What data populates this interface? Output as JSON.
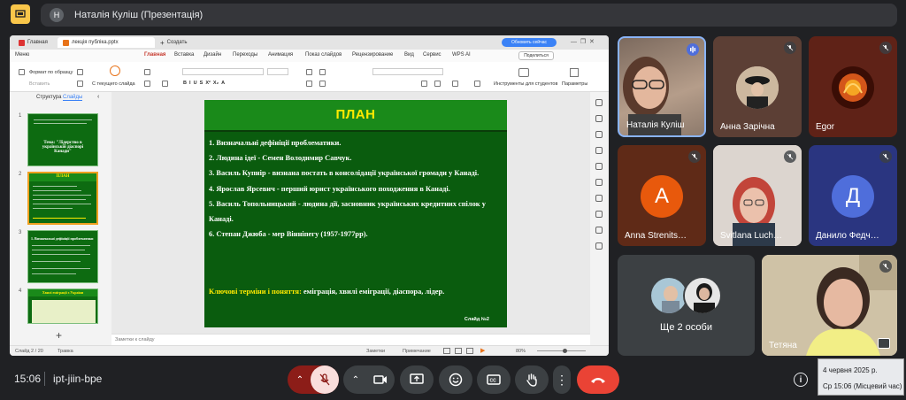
{
  "topbar": {
    "presenter_initial": "Н",
    "presenter_title": "Наталія Куліш (Презентація)"
  },
  "wps": {
    "tabs": [
      "Главная",
      "лекція публіка.pptx",
      "Создать"
    ],
    "update_label": "Обновить сейчас",
    "menu": [
      "Меню",
      "Главная",
      "Вставка",
      "Дизайн",
      "Переходы",
      "Анимация",
      "Показ слайдов",
      "Рецензирование",
      "Вид",
      "Сервис",
      "WPS AI"
    ],
    "share_label": "Поделиться",
    "ribbon": {
      "format_painter": "Формат по образцу",
      "paste": "Вставить",
      "from_current": "С текущего слайда",
      "student_tools": "Инструменты для студентов",
      "params": "Параметры"
    },
    "panel_tabs": [
      "Структура",
      "Слайды"
    ],
    "thumbnails": [
      {
        "num": "1",
        "title": "Тема: \"Лідерство в українській діаспорі Канади\""
      },
      {
        "num": "2",
        "title": "ПЛАН"
      },
      {
        "num": "3",
        "title": "1. Визначальні дефініції проблематики"
      },
      {
        "num": "4",
        "title": "Хвилі еміграції з України"
      }
    ],
    "notes_placeholder": "Заметки к слайду",
    "status": {
      "slide_info": "Слайд 2 / 20",
      "theme": "Травка",
      "notes": "Заметки",
      "comment": "Примечание",
      "zoom": "80%"
    }
  },
  "slide": {
    "title": "ПЛАН",
    "items": [
      "1. Визначальні дефініції проблематики.",
      "2. Людина ідеї - Семен Володимир Савчук.",
      "3. Василь Купнір - визнана постать в консолідації української громади у Канаді.",
      "4. Ярослав Ярсевич - перший юрист українського походження в Канаді.",
      "5. Василь Топольницький - людина дії, засновник українських кредитних спілок у Канаді.",
      "6. Степан Джюба - мер Вінніпегу (1957-1977рр)."
    ],
    "keys_label": "Ключові терміни і поняття:",
    "keys_text": " еміграція, хвилі еміграції, діаспора, лідер.",
    "number": "Слайд №2"
  },
  "participants": [
    {
      "name": "Наталія Куліш",
      "speaking": true
    },
    {
      "name": "Анна Зарічна",
      "muted": true
    },
    {
      "name": "Egor",
      "muted": true
    },
    {
      "name": "Anna Strenits…",
      "initial": "А",
      "color": "#e8590c",
      "muted": true
    },
    {
      "name": "Svitlana Luch…",
      "muted": true
    },
    {
      "name": "Данило Федч…",
      "initial": "Д",
      "color": "#4f6edb",
      "muted": true
    },
    {
      "name": "Ще 2 особи"
    },
    {
      "name": "Тетяна",
      "muted": true
    }
  ],
  "bottom": {
    "time": "15:06",
    "meeting_code": "ipt-jiin-bpe",
    "tooltip_date": "4 червня 2025 р.",
    "tooltip_time": "Ср 15:06 (Місцевий час)"
  },
  "colors": {
    "background": "#202124",
    "slide_green": "#0a5c0e",
    "slide_title": "#ffea00",
    "end_call": "#ea4335"
  }
}
